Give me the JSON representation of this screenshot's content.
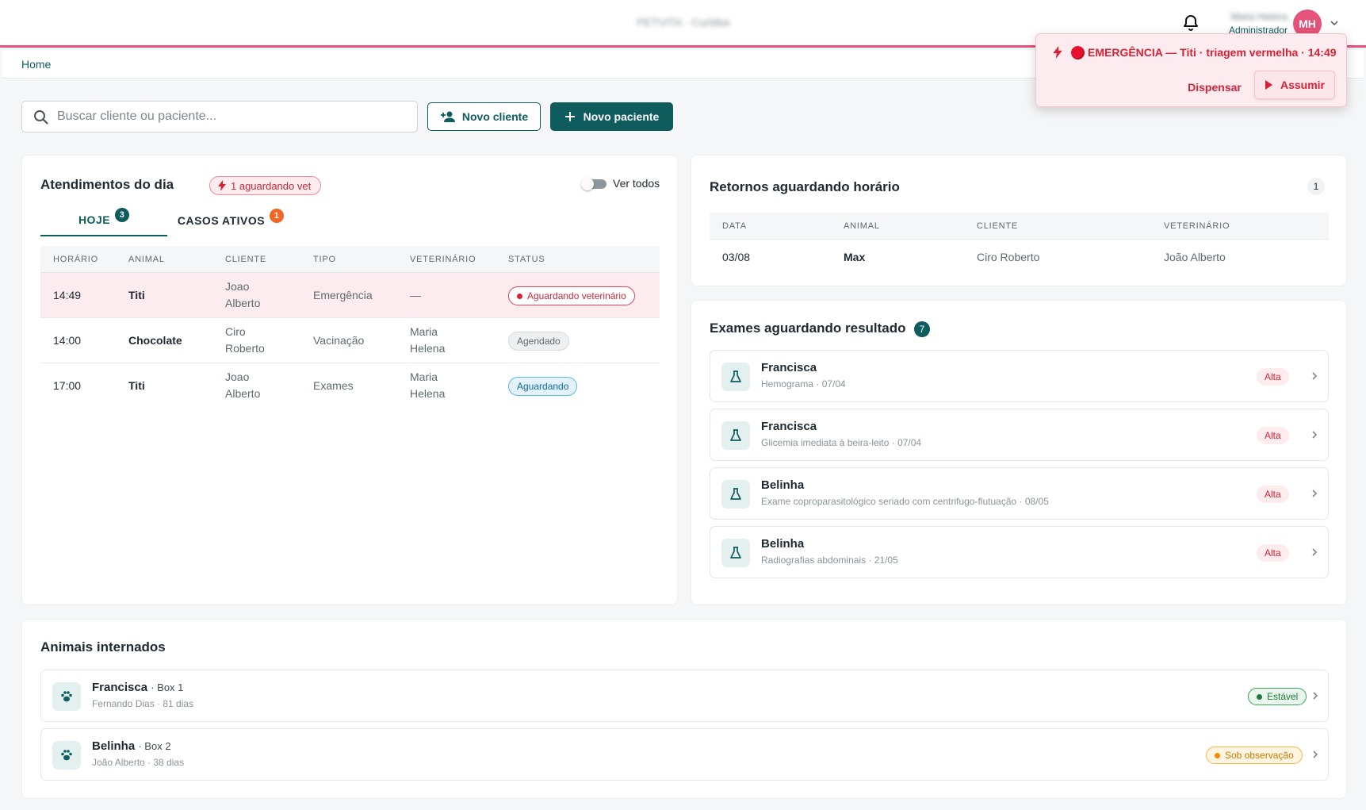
{
  "topbar": {
    "brand": "PETVITA · Curitiba",
    "user_name": "Maria Helena",
    "user_role": "Administrador",
    "avatar_initials": "MH"
  },
  "breadcrumb": {
    "home": "Home"
  },
  "search": {
    "placeholder": "Buscar cliente ou paciente..."
  },
  "actions": {
    "new_client": "Novo cliente",
    "new_patient": "Novo paciente"
  },
  "atendimentos": {
    "title": "Atendimentos do dia",
    "alert_pill": "1 aguardando vet",
    "toggle_label": "Ver todos",
    "tabs": [
      {
        "label": "HOJE",
        "count": "3"
      },
      {
        "label": "CASOS ATIVOS",
        "count": "1"
      }
    ],
    "columns": [
      "HORÁRIO",
      "ANIMAL",
      "CLIENTE",
      "TIPO",
      "VETERINÁRIO",
      "STATUS"
    ],
    "rows": [
      {
        "time": "14:49",
        "animal": "Titi",
        "client_1": "Joao",
        "client_2": "Alberto",
        "type": "Emergência",
        "vet_1": "—",
        "vet_2": "",
        "status": "Aguardando veterinário"
      },
      {
        "time": "14:00",
        "animal": "Chocolate",
        "client_1": "Ciro",
        "client_2": "Roberto",
        "type": "Vacinação",
        "vet_1": "Maria",
        "vet_2": "Helena",
        "status": "Agendado"
      },
      {
        "time": "17:00",
        "animal": "Titi",
        "client_1": "Joao",
        "client_2": "Alberto",
        "type": "Exames",
        "vet_1": "Maria",
        "vet_2": "Helena",
        "status": "Aguardando"
      }
    ]
  },
  "retornos": {
    "title": "Retornos aguardando horário",
    "count": "1",
    "columns": [
      "DATA",
      "ANIMAL",
      "CLIENTE",
      "VETERINÁRIO"
    ],
    "rows": [
      {
        "date": "03/08",
        "animal": "Max",
        "client": "Ciro Roberto",
        "vet": "João Alberto"
      }
    ]
  },
  "exames": {
    "title": "Exames aguardando resultado",
    "count": "7",
    "items": [
      {
        "animal": "Francisca",
        "detail": "Hemograma · 07/04",
        "priority": "Alta"
      },
      {
        "animal": "Francisca",
        "detail": "Glicemia imediata à beira-leito · 07/04",
        "priority": "Alta"
      },
      {
        "animal": "Belinha",
        "detail": "Exame coproparasitológico seriado com centrifugo-flutuação · 08/05",
        "priority": "Alta"
      },
      {
        "animal": "Belinha",
        "detail": "Radiografias abdominais · 21/05",
        "priority": "Alta"
      }
    ]
  },
  "internados": {
    "title": "Animais internados",
    "items": [
      {
        "animal": "Francisca",
        "box": "· Box 1",
        "detail": "Fernando Dias · 81 dias",
        "status": "Estável"
      },
      {
        "animal": "Belinha",
        "box": "· Box 2",
        "detail": "João Alberto · 38 dias",
        "status": "Sob observação"
      }
    ]
  },
  "toast": {
    "text": "EMERGÊNCIA — Titi · triagem vermelha · 14:49",
    "dismiss": "Dispensar",
    "accept": "Assumir"
  },
  "colors": {
    "primary": "#0f5c5e",
    "accent": "#e5527a",
    "danger": "#d62238",
    "warning": "#f08c00",
    "success": "#1c7a3c"
  },
  "icons": {
    "bell": "bell-icon",
    "search": "search-icon",
    "add_user": "add-user-icon",
    "plus": "plus-icon",
    "bolt": "lightning-icon",
    "flask": "flask-icon",
    "paw": "paw-icon",
    "chevron": "chevron-right-icon",
    "play": "play-icon"
  }
}
